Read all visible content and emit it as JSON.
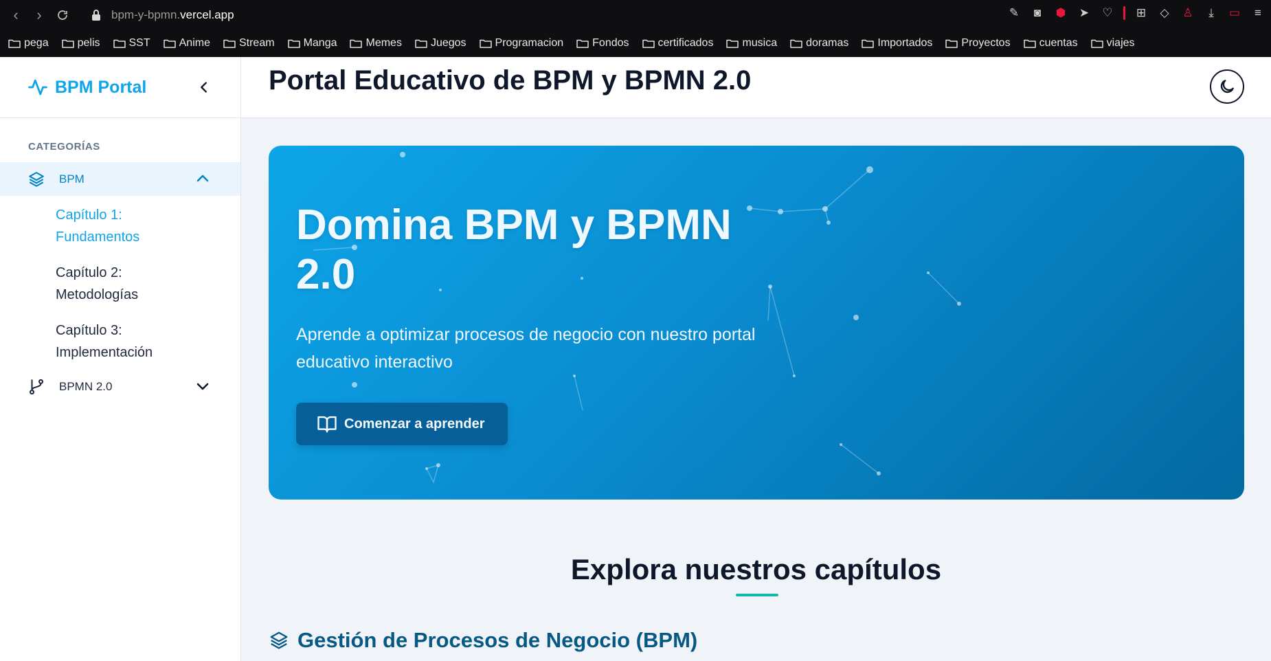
{
  "browser": {
    "url_prefix": "bpm-y-bpmn.",
    "url_host": "vercel.app",
    "bookmarks": [
      "pega",
      "pelis",
      "SST",
      "Anime",
      "Stream",
      "Manga",
      "Memes",
      "Juegos",
      "Programacion",
      "Fondos",
      "certificados",
      "musica",
      "doramas",
      "Importados",
      "Proyectos",
      "cuentas",
      "viajes"
    ]
  },
  "sidebar": {
    "brand": "BPM Portal",
    "categories_label": "CATEGORÍAS",
    "bpm_label": "BPM",
    "chapters": [
      {
        "line1": "Capítulo 1:",
        "line2": "Fundamentos"
      },
      {
        "line1": "Capítulo 2:",
        "line2": "Metodologías"
      },
      {
        "line1": "Capítulo 3:",
        "line2": "Implementación"
      }
    ],
    "bpmn_label": "BPMN 2.0"
  },
  "header": {
    "title": "Portal Educativo de BPM y BPMN 2.0"
  },
  "hero": {
    "title": "Domina BPM y BPMN 2.0",
    "subtitle": "Aprende a optimizar procesos de negocio con nuestro portal educativo interactivo",
    "cta": "Comenzar a aprender"
  },
  "section": {
    "title": "Explora nuestros capítulos",
    "subsection": "Gestión de Procesos de Negocio (BPM)"
  },
  "colors": {
    "accent": "#0ea5e9",
    "hero_start": "#0ea5e9",
    "hero_end": "#0369a1",
    "underline": "#14b8a6"
  }
}
